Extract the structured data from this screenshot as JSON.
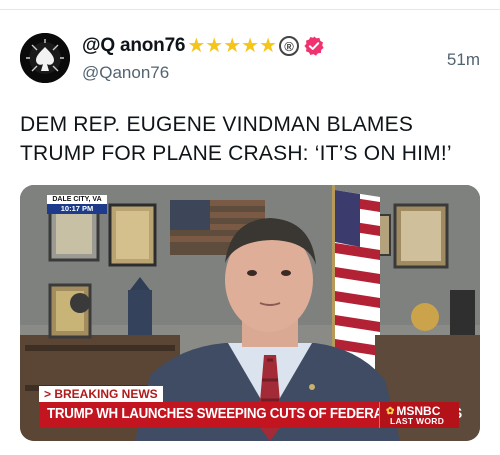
{
  "post": {
    "display_name": "@Q anon76",
    "star_icons": [
      "star-icon",
      "star-icon",
      "star-icon",
      "star-icon",
      "star-icon"
    ],
    "registered_mark": "®",
    "handle": "@Qanon76",
    "timestamp": "51m",
    "text_line1": "DEM REP. EUGENE VINDMAN BLAMES",
    "text_line2": "TRUMP FOR PLANE CRASH: ‘IT’S ON HIM!’"
  },
  "video": {
    "dateline_city": "DALE CITY, VA",
    "dateline_time": "10:17 PM",
    "breaking_label": "> BREAKING NEWS",
    "headline": "TRUMP WH LAUNCHES SWEEPING CUTS OF FEDERAL WORKERS",
    "network": "MSNBC",
    "show": "LAST WORD"
  },
  "colors": {
    "star": "#f5c518",
    "verified": "#f0336e",
    "breaking_red": "#c2151f",
    "handle_gray": "#536471"
  }
}
